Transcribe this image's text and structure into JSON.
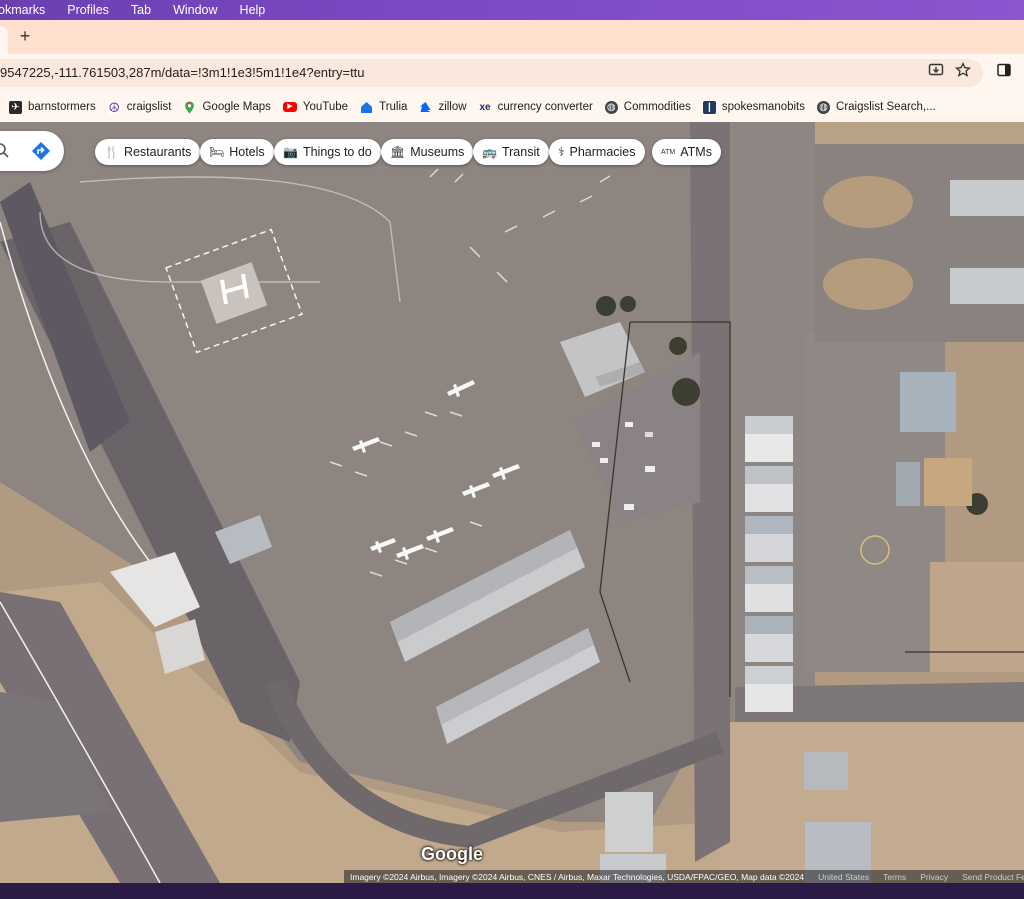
{
  "menubar": {
    "items": [
      "okmarks",
      "Profiles",
      "Tab",
      "Window",
      "Help"
    ]
  },
  "tabs": {
    "new_tab_label": "+"
  },
  "toolbar": {
    "url": "9547225,-111.761503,287m/data=!3m1!1e3!5m1!1e4?entry=ttu",
    "install_icon": "install-app-icon",
    "bookmark_icon": "star-icon",
    "sidepanel_icon": "side-panel-icon"
  },
  "bookmarks": [
    {
      "label": "barnstormers",
      "icon": "barnstormers-icon",
      "color": "#2b2b2b"
    },
    {
      "label": "craigslist",
      "icon": "peace-icon",
      "color": "#6a2c91"
    },
    {
      "label": "Google Maps",
      "icon": "maps-pin-icon",
      "color": "#34a853"
    },
    {
      "label": "YouTube",
      "icon": "youtube-icon",
      "color": "#ff0000"
    },
    {
      "label": "Trulia",
      "icon": "trulia-icon",
      "color": "#1a73e8"
    },
    {
      "label": "zillow",
      "icon": "zillow-icon",
      "color": "#006aff"
    },
    {
      "label": "currency converter",
      "icon": "xe-icon",
      "color": "#1a2a6c"
    },
    {
      "label": "Commodities",
      "icon": "globe-icon",
      "color": "#444444"
    },
    {
      "label": "spokesmanobits",
      "icon": "spokesman-icon",
      "color": "#1e3a5f"
    },
    {
      "label": "Craigslist Search,...",
      "icon": "globe-icon",
      "color": "#444444"
    }
  ],
  "map": {
    "chips": [
      {
        "label": "Restaurants",
        "icon": "fork-knife-icon"
      },
      {
        "label": "Hotels",
        "icon": "bed-icon"
      },
      {
        "label": "Things to do",
        "icon": "camera-icon"
      },
      {
        "label": "Museums",
        "icon": "museum-icon"
      },
      {
        "label": "Transit",
        "icon": "bus-icon"
      },
      {
        "label": "Pharmacies",
        "icon": "pharmacy-icon"
      },
      {
        "label": "ATMs",
        "icon": "atm-icon"
      }
    ],
    "logo": "Google",
    "attribution": "Imagery ©2024 Airbus, Imagery ©2024 Airbus, CNES / Airbus, Maxar Technologies, USDA/FPAC/GEO, Map data ©2024",
    "footer_links": [
      "United States",
      "Terms",
      "Privacy",
      "Send Product Feedback"
    ]
  }
}
